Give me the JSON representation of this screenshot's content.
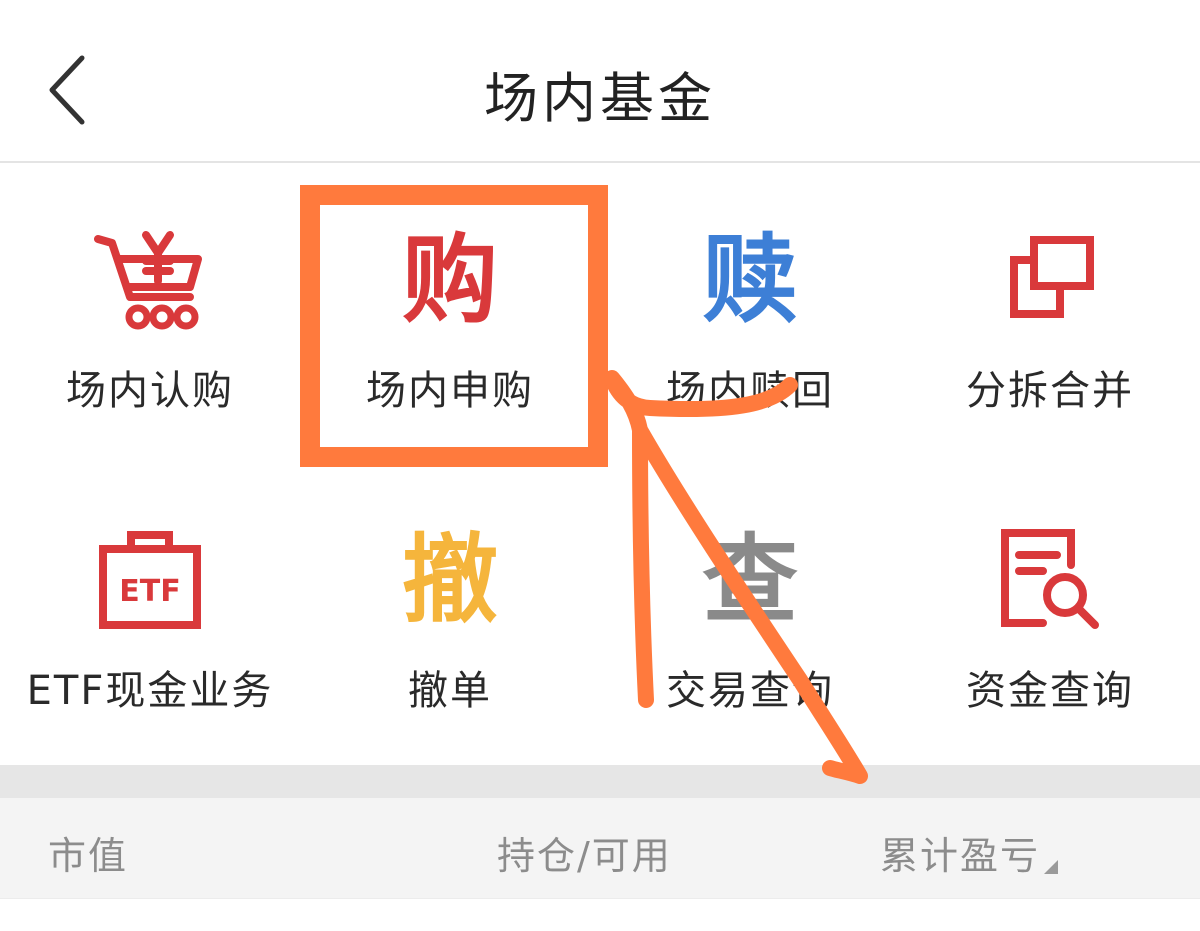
{
  "header": {
    "title": "场内基金",
    "back_icon": "chevron-left-icon"
  },
  "grid": {
    "items": [
      {
        "label": "场内认购",
        "icon": "cart-yen-icon",
        "color": "#d9393b"
      },
      {
        "label": "场内申购",
        "icon": "gou-char-icon",
        "glyph": "购",
        "color": "#d9393b"
      },
      {
        "label": "场内赎回",
        "icon": "shu-char-icon",
        "glyph": "赎",
        "color": "#3d7fd6"
      },
      {
        "label": "分拆合并",
        "icon": "split-merge-icon",
        "color": "#d9393b"
      },
      {
        "label": "ETF现金业务",
        "icon": "etf-briefcase-icon",
        "color": "#d9393b"
      },
      {
        "label": "撤单",
        "icon": "che-char-icon",
        "glyph": "撤",
        "color": "#f5b53c"
      },
      {
        "label": "交易查询",
        "icon": "cha-char-icon",
        "glyph": "查",
        "color": "#8a8a8a"
      },
      {
        "label": "资金查询",
        "icon": "document-search-icon",
        "color": "#d9393b"
      }
    ]
  },
  "etf_icon_text": "ETF",
  "table_header": {
    "col1": "市值",
    "col2": "持仓/可用",
    "col3": "累计盈亏"
  },
  "annotation": {
    "color": "#ff7a3d"
  }
}
